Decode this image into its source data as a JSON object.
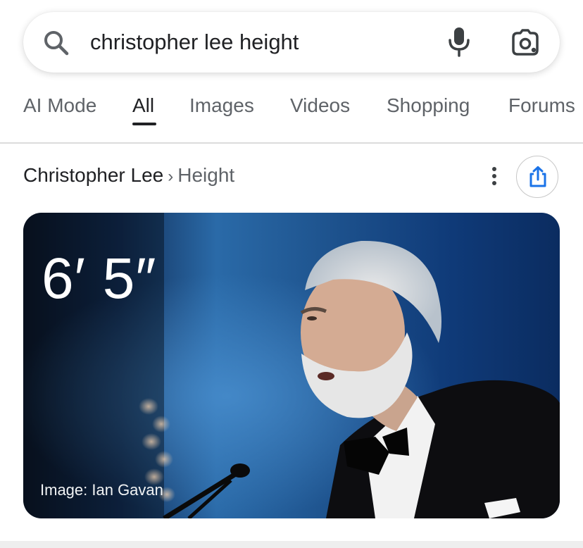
{
  "search": {
    "query": "christopher lee height"
  },
  "tabs": [
    {
      "label": "AI Mode"
    },
    {
      "label": "All"
    },
    {
      "label": "Images"
    },
    {
      "label": "Videos"
    },
    {
      "label": "Shopping"
    },
    {
      "label": "Forums"
    }
  ],
  "breadcrumb": {
    "entity": "Christopher Lee",
    "separator": "›",
    "attribute": "Height"
  },
  "answer": {
    "value": "6′ 5″",
    "image_credit": "Image: Ian Gavan"
  },
  "icons": [
    "search-icon",
    "mic-icon",
    "lens-icon",
    "more-vert-icon",
    "share-icon"
  ],
  "colors": {
    "accent": "#1a73e8",
    "text": "#202124",
    "muted": "#5f6368"
  }
}
